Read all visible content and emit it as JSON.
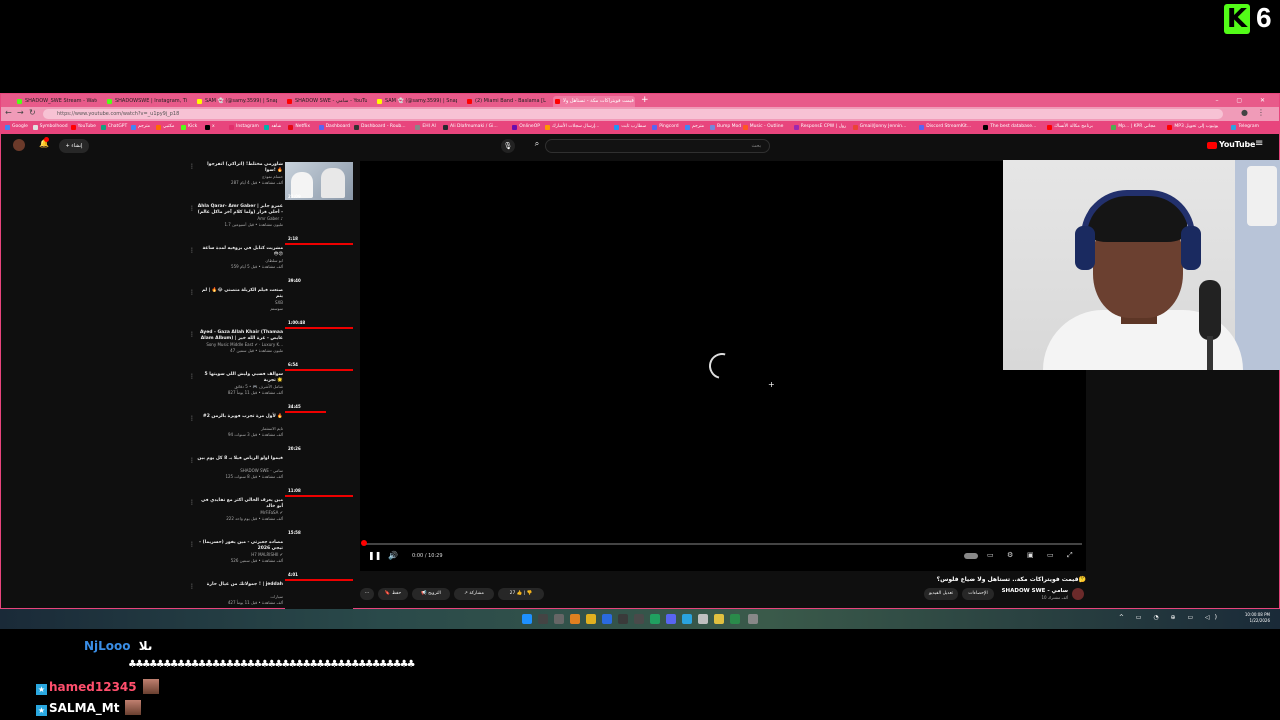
{
  "overlay": {
    "kick_letter": "K",
    "kick_number": "6"
  },
  "browser": {
    "tabs": [
      {
        "label": "SHADOW_SWE Stream - Watch Li",
        "fav": "#53fc18",
        "left": 0
      },
      {
        "label": "SHADOWSWE | Instagram, TikTok",
        "fav": "#53fc18",
        "left": 0
      },
      {
        "label": "SAM 👻 (@samy.3599) | Snap",
        "fav": "#fffc00",
        "left": 0
      },
      {
        "label": "SHADOW SWE - سامي - YouTube",
        "fav": "#ff0000",
        "left": 0
      },
      {
        "label": "SAM 👻 (@samy.3599) | Snap",
        "fav": "#fffc00",
        "left": 0
      },
      {
        "label": "(2) Miami Band - Baslama [L 2016",
        "fav": "#ff0000",
        "left": 0
      },
      {
        "label": "قيمت فويتراكات مكة - تستاهل ولا",
        "fav": "#ff0000",
        "left": 0
      }
    ],
    "new_tab": "+",
    "window_controls": "– ▢ ✕",
    "url": "https://www.youtube.com/watch?v=_u1py9j_p18",
    "bookmarks": [
      {
        "label": "Google",
        "fav": "#4285f4"
      },
      {
        "label": "Symbolhood",
        "fav": "#e0e0e0"
      },
      {
        "label": "YouTube",
        "fav": "#ff0000"
      },
      {
        "label": "ChatGPT",
        "fav": "#10a37f"
      },
      {
        "label": "مترجم",
        "fav": "#4285f4"
      },
      {
        "label": "مكتبي",
        "fav": "#ff6a00"
      },
      {
        "label": "Kick",
        "fav": "#53fc18"
      },
      {
        "label": "x",
        "fav": "#000000"
      },
      {
        "label": "Instagram",
        "fav": "#e1306c"
      },
      {
        "label": "شاهد",
        "fav": "#00b2a9"
      },
      {
        "label": "Netflix",
        "fav": "#e50914"
      },
      {
        "label": "Dashboard",
        "fav": "#5865f2"
      },
      {
        "label": "Dashboard - Roub...",
        "fav": "#333333"
      },
      {
        "label": "EHI AI",
        "fav": "#888888"
      },
      {
        "label": "Ali Dlafmumaki / Gi...",
        "fav": "#24292e"
      },
      {
        "label": "OnlineOP",
        "fav": "#6a0dad"
      },
      {
        "label": "إرسال سجلات الأشارك...",
        "fav": "#ff9800"
      },
      {
        "label": "سطارب ثابت",
        "fav": "#2196f3"
      },
      {
        "label": "Pingcord",
        "fav": "#5865f2"
      },
      {
        "label": "مترجم",
        "fav": "#4285f4"
      },
      {
        "label": "Bump Mod",
        "fav": "#7289da"
      },
      {
        "label": "Music - Outline",
        "fav": "#ff5722"
      },
      {
        "label": "ResponsE CPW | رول",
        "fav": "#9c27b0"
      },
      {
        "label": "Gmail/Jonny Jennin...",
        "fav": "#ea4335"
      },
      {
        "label": "Discord StreamKit...",
        "fav": "#5865f2"
      },
      {
        "label": "The best database...",
        "fav": "#000000"
      },
      {
        "label": "برنامج مكالة الأنساك",
        "fav": "#ff0000"
      },
      {
        "label": "Mp... | KPR مجاني",
        "fav": "#4caf50"
      },
      {
        "label": "MP3 يوتيوب إلى تحويل",
        "fav": "#ff0000"
      },
      {
        "label": "Telegram",
        "fav": "#2aa3df"
      }
    ]
  },
  "youtube": {
    "logo": "YouTube",
    "create_label": "+ إنشاء",
    "search_placeholder": "بحث",
    "player": {
      "time": "0:00 / 10:29"
    },
    "video": {
      "title": "قيمت فويتراكات مكة.. تستاهل ولا ضياع فلوس؟🤔",
      "channel": "SHADOW SWE - سامي",
      "subscribers": "10 ألف مشترك",
      "subscribe_label": "الاشتراك",
      "join_label": "الإحصاءات",
      "analytics_label": "تعديل الفيديو",
      "likes": "27",
      "share_label": "مشاركة",
      "promote_label": "الترويج",
      "save_label": "حفظ"
    },
    "sidebar": [
      {
        "title": "شاورمي مختلط! (اتراكي) اتفرجوا سوا! 🔥",
        "channel": "حسام نموذج",
        "meta": "287 ألف مشاهدة • قبل 4 أيام",
        "duration": "23:09",
        "progress": 0
      },
      {
        "title": "Ahla Qarar- Amr Gaber | عمرو جابر - أحلى قرار (ولما كلام آخر ماكل عالم)",
        "channel": "Amr Gaber ♪",
        "meta": "1.7 مليون مشاهدة • قبل أسبوعين",
        "duration": "2:18",
        "progress": 1.0
      },
      {
        "title": "مشريت كتابل في بروفيه لمدة ساعة 😳😡",
        "channel": "ابو سلطان",
        "meta": "559 ألف مشاهدة • قبل 5 أيام",
        "duration": "39:40",
        "progress": 0
      },
      {
        "title": "صنعت فيلم الكربلة منصني 😂🔥 | لم يتم",
        "channel": "SXB",
        "meta": "سوستم",
        "duration": "1:00:48",
        "progress": 1.0
      },
      {
        "title": "Ayed - Gaza Allah Khair (Thamaa Alam Album) | عايض - غزة الله خير",
        "channel": "Sony Music Middle East ✔ · Luxury K...",
        "meta": "47 مليون مشاهدة • قبل سنتين",
        "duration": "6:54",
        "progress": 1.0
      },
      {
        "title": "سوالف فسبي وليش اللي سويتها 5 تجربة 🌟",
        "channel": "شامل الأشرف 🎮 • 5 دقائق",
        "meta": "827 ألف مشاهدة • قبل 11 يوماً",
        "duration": "34:45",
        "progress": 0.6
      },
      {
        "title": "#2 لأول مرة تجرب فويرة بالزمن 🔥",
        "channel": "تايم الاستثمار",
        "meta": "94 ألف مشاهدة • قبل 3 سنوات",
        "duration": "20:26",
        "progress": 0
      },
      {
        "title": "قيموا اولو الرياض فيلا بـ 8 كل يوم بين",
        "channel": "SHADOW SWE - سامي",
        "meta": "125 ألف مشاهدة • قبل 8 سنوات",
        "duration": "11:08",
        "progress": 1.0
      },
      {
        "title": "مين يعرف الخالي اكثر مع نفايدي في أبو خالد",
        "channel": "MrFiFaSA ✔",
        "meta": "222 ألف مشاهدة • قبل يوم واحد",
        "duration": "15:58",
        "progress": 0
      },
      {
        "title": "مصاده جعبرتي - مين يفوز (حسريما) - تيجي 2026",
        "channel": "H7 MALRISHII ✔",
        "meta": "526 ألف مشاهدة • قبل سنتين",
        "duration": "4:01",
        "progress": 1.0
      },
      {
        "title": "جمولاتك من عيال حارة ! | jeddah",
        "channel": "سيارات",
        "meta": "427 ألف مشاهدة • قبل 11 يوماً",
        "duration": "",
        "progress": 0
      }
    ]
  },
  "taskbar": {
    "time": "10:00:08 PM",
    "date": "1/22/2026",
    "tray": "^ ▭ ◔ ⊕ ▭ ◁)"
  },
  "chat": [
    {
      "user": "NjLooo",
      "user_color": "#3a8ee6",
      "message": "ىلا",
      "badge": false,
      "emote": false
    },
    {
      "user": "",
      "user_color": "#ffffff",
      "message": "\\u2663\\u2663\\u2663",
      "badge": false,
      "emote": false
    },
    {
      "user": "hamed12345",
      "user_color": "#ff4f6d",
      "message": "",
      "badge": true,
      "emote": true
    },
    {
      "user": "SALMA_Mt",
      "user_color": "#ffffff",
      "message": "",
      "badge": true,
      "emote": true
    }
  ],
  "chat_spam": "♣♣♣♣♣♣♣♣♣♣♣♣♣♣♣♣♣♣♣♣♣♣♣♣♣♣♣♣♣♣♣♣♣♣♣♣♣♣♣♣♣"
}
